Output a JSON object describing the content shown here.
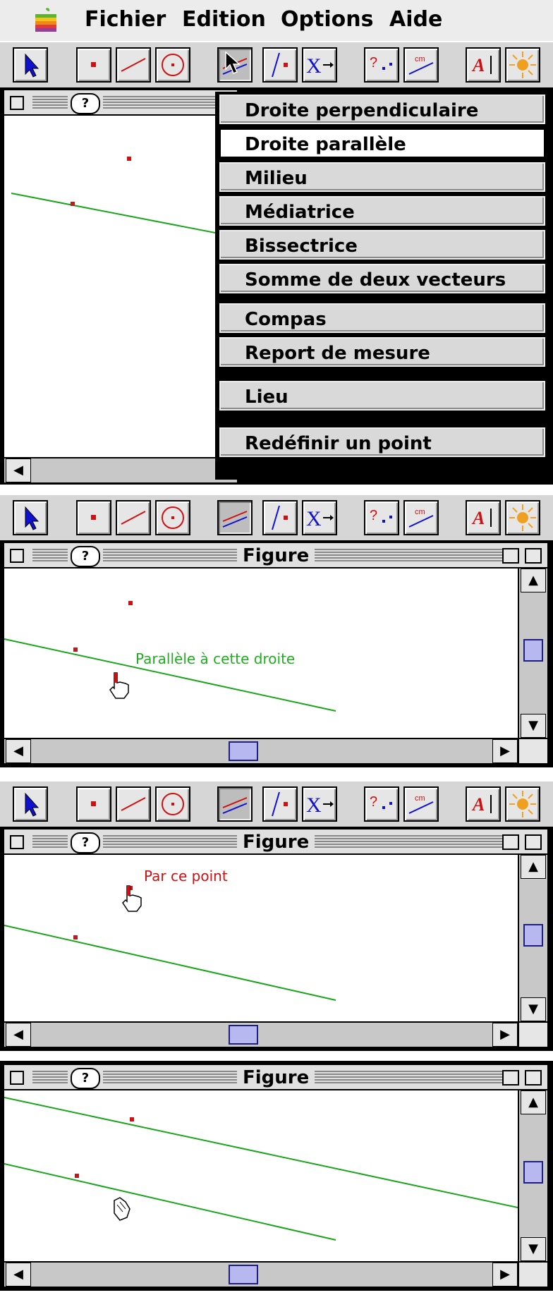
{
  "menubar": {
    "items": [
      "Fichier",
      "Edition",
      "Options",
      "Aide"
    ]
  },
  "dropdown": {
    "items": [
      {
        "label": "Droite perpendiculaire",
        "selected": false
      },
      {
        "label": "Droite parallèle",
        "selected": true
      },
      {
        "label": "Milieu",
        "selected": false
      },
      {
        "label": "Médiatrice",
        "selected": false
      },
      {
        "label": "Bissectrice",
        "selected": false
      },
      {
        "label": "Somme de deux vecteurs",
        "selected": false
      },
      {
        "label": "Compas",
        "selected": false
      },
      {
        "label": "Report de mesure",
        "selected": false
      },
      {
        "label": "Lieu",
        "selected": false
      },
      {
        "label": "Redéfinir un point",
        "selected": false
      }
    ]
  },
  "window": {
    "title": "Figure",
    "help": "?"
  },
  "prompts": {
    "step2": "Parallèle à cette droite",
    "step3": "Par ce point"
  },
  "colors": {
    "line": "#1aa61a",
    "point": "#d01010",
    "prompt_green": "#1fae1f",
    "prompt_red": "#d01010",
    "toolbar_blue": "#1010d0"
  },
  "icons": [
    "arrow-select-icon",
    "point-icon",
    "line-icon",
    "circle-icon",
    "construct-lines-icon",
    "intersection-icon",
    "transform-icon",
    "measure-icon",
    "length-icon",
    "text-icon",
    "display-icon"
  ]
}
